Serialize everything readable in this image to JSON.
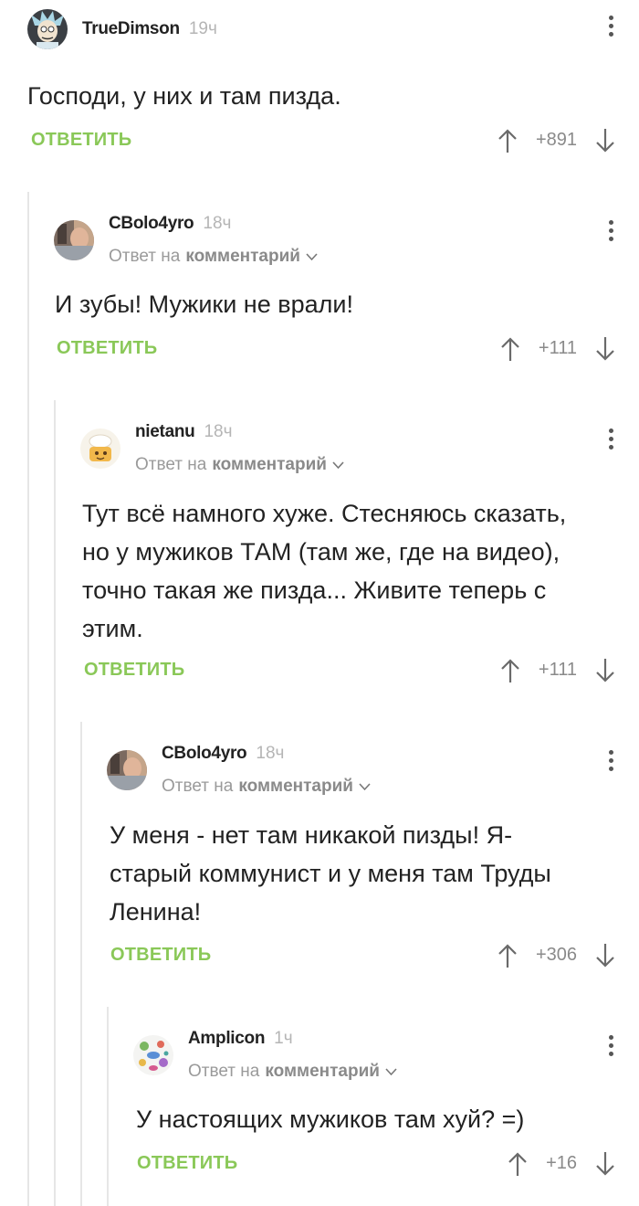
{
  "comments": [
    {
      "username": "TrueDimson",
      "time": "19ч",
      "reply_to": null,
      "text": "Господи, у них и там пизда.",
      "reply_label": "ОТВЕТИТЬ",
      "score": "+891",
      "avatar": "rick-avatar"
    },
    {
      "username": "CBolo4yro",
      "time": "18ч",
      "reply_to": {
        "prefix": "Ответ на",
        "target": "комментарий"
      },
      "text": "И зубы! Мужики не врали!",
      "reply_label": "ОТВЕТИТЬ",
      "score": "+111",
      "avatar": "photo-avatar"
    },
    {
      "username": "nietanu",
      "time": "18ч",
      "reply_to": {
        "prefix": "Ответ на",
        "target": "комментарий"
      },
      "text_lines": [
        "Тут всё намного хуже. Стесняюсь сказать,",
        "но у мужиков ТАМ (там же, где на видео),",
        "точно такая же пизда... Живите теперь с",
        "этим."
      ],
      "reply_label": "ОТВЕТИТЬ",
      "score": "+111",
      "avatar": "chef-avatar"
    },
    {
      "username": "CBolo4yro",
      "time": "18ч",
      "reply_to": {
        "prefix": "Ответ на",
        "target": "комментарий"
      },
      "text_lines": [
        "У меня - нет там никакой пизды! Я-",
        "старый коммунист и у меня там Труды",
        "Ленина!"
      ],
      "reply_label": "ОТВЕТИТЬ",
      "score": "+306",
      "avatar": "photo-avatar"
    },
    {
      "username": "Amplicon",
      "time": "1ч",
      "reply_to": {
        "prefix": "Ответ на",
        "target": "комментарий"
      },
      "text": "У настоящих мужиков там хуй? =)",
      "reply_label": "ОТВЕТИТЬ",
      "score": "+16",
      "avatar": "microbes-avatar"
    }
  ],
  "colors": {
    "reply": "#8ac858",
    "username": "#222222",
    "muted": "#9a9a9a",
    "thread_line": "#e6e6e6"
  }
}
